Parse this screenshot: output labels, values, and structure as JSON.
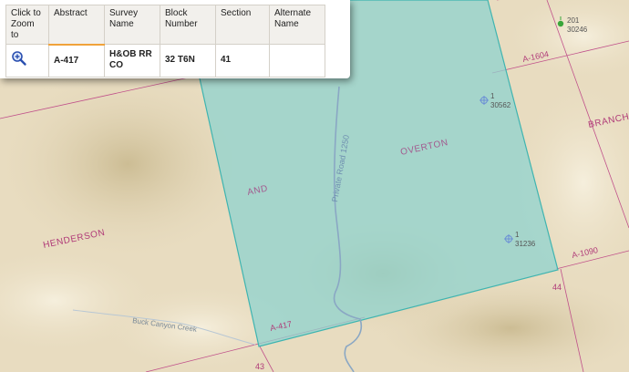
{
  "popup": {
    "columns": [
      "Click to Zoom to",
      "Abstract",
      "Survey Name",
      "Block Number",
      "Section",
      "Alternate Name"
    ],
    "row": {
      "zoom_icon": "magnifier-zoom-icon",
      "abstract": "A-417",
      "survey_name": "H&OB RR CO",
      "block_number": "32 T6N",
      "section": "41",
      "alternate_name": ""
    }
  },
  "map": {
    "colors": {
      "terrain": "#e8dcc0",
      "parcel_fill": "#8fd3cf",
      "parcel_stroke": "#3fb4b0",
      "survey_line": "#c0508a",
      "survey_label": "#b03a78",
      "road": "#8aa7c4",
      "well_symbol": "#6b8fd6",
      "well_active": "#3aa63a"
    },
    "survey_labels": [
      "HENDERSON",
      "AND",
      "OVERTON",
      "BRANCH"
    ],
    "abstract_labels": [
      "A-1604",
      "A-1090",
      "A-417"
    ],
    "section_numbers": [
      "44",
      "43"
    ],
    "road_labels": [
      "Private Road 1250",
      "Buck Canyon Creek"
    ],
    "wells": [
      {
        "label": "1",
        "api": "30562",
        "icon": "well-location-icon"
      },
      {
        "label": "1",
        "api": "31236",
        "icon": "well-location-icon"
      },
      {
        "label": "201",
        "api": "30246",
        "icon": "active-well-icon"
      }
    ]
  }
}
